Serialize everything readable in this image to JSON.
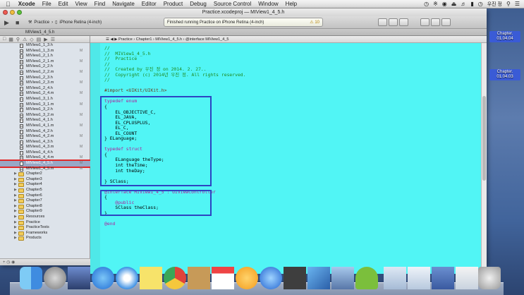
{
  "menubar": {
    "items": [
      "Xcode",
      "File",
      "Edit",
      "View",
      "Find",
      "Navigate",
      "Editor",
      "Product",
      "Debug",
      "Source Control",
      "Window",
      "Help"
    ],
    "user": "우진 정"
  },
  "window": {
    "title": "Practice.xcodeproj — MIView1_4_5.h",
    "scheme": "Practice",
    "destination": "iPhone Retina (4-inch)",
    "status": "Finished running Practice on iPhone Retina (4-inch)",
    "warning_count": "10",
    "tab": "MIView1_4_5.h"
  },
  "jumpbar": {
    "path": [
      "Practice",
      "Chapter1",
      "MIView1_4_5.h",
      "@interface MIView1_4_5"
    ]
  },
  "navigator": {
    "files": [
      {
        "type": "h",
        "name": "MIView1_1_3.h",
        "mark": ""
      },
      {
        "type": "m",
        "name": "MIView1_1_3.m",
        "mark": "M"
      },
      {
        "type": "h",
        "name": "MIView1_2_1.h",
        "mark": ""
      },
      {
        "type": "m",
        "name": "MIView1_2_1.m",
        "mark": "M"
      },
      {
        "type": "h",
        "name": "MIView1_2_2.h",
        "mark": ""
      },
      {
        "type": "m",
        "name": "MIView1_2_2.m",
        "mark": "M"
      },
      {
        "type": "h",
        "name": "MIView1_2_3.h",
        "mark": ""
      },
      {
        "type": "m",
        "name": "MIView1_2_3.m",
        "mark": "M"
      },
      {
        "type": "h",
        "name": "MIView1_2_4.h",
        "mark": ""
      },
      {
        "type": "m",
        "name": "MIView1_2_4.m",
        "mark": "M"
      },
      {
        "type": "h",
        "name": "MIView1_3_1.h",
        "mark": ""
      },
      {
        "type": "m",
        "name": "MIView1_3_1.m",
        "mark": "M"
      },
      {
        "type": "h",
        "name": "MIView1_3_2.h",
        "mark": ""
      },
      {
        "type": "m",
        "name": "MIView1_3_2.m",
        "mark": "M"
      },
      {
        "type": "h",
        "name": "MIView1_4_1.h",
        "mark": ""
      },
      {
        "type": "m",
        "name": "MIView1_4_1.m",
        "mark": "M"
      },
      {
        "type": "h",
        "name": "MIView1_4_2.h",
        "mark": ""
      },
      {
        "type": "m",
        "name": "MIView1_4_2.m",
        "mark": "M"
      },
      {
        "type": "h",
        "name": "MIView1_4_3.h",
        "mark": ""
      },
      {
        "type": "m",
        "name": "MIView1_4_3.m",
        "mark": "M"
      },
      {
        "type": "h",
        "name": "MIView1_4_4.h",
        "mark": ""
      },
      {
        "type": "m",
        "name": "MIView1_4_4.m",
        "mark": "M"
      },
      {
        "type": "h",
        "name": "MIView1_4_5.h",
        "mark": "M",
        "selected": true
      },
      {
        "type": "m",
        "name": "MIView1_4_5.m",
        "mark": "M"
      }
    ],
    "folders": [
      "Chapter2",
      "Chapter3",
      "Chapter4",
      "Chapter5",
      "Chapter6",
      "Chapter7",
      "Chapter8",
      "Chapter9",
      "Resources",
      "Practice",
      "PracticeTests",
      "Frameworks",
      "Products"
    ]
  },
  "code": {
    "lines": [
      {
        "cls": "cm",
        "text": "//"
      },
      {
        "cls": "cm",
        "text": "//  MIView1_4_5.h"
      },
      {
        "cls": "cm",
        "text": "//  Practice"
      },
      {
        "cls": "cm",
        "text": "//"
      },
      {
        "cls": "cm",
        "text": "//  Created by 우진 정 on 2014. 2. 27.."
      },
      {
        "cls": "cm",
        "text": "//  Copyright (c) 2014년 우진 정. All rights reserved."
      },
      {
        "cls": "cm",
        "text": "//"
      },
      {
        "cls": "",
        "text": ""
      },
      {
        "cls": "pp",
        "text": "#import <UIKit/UIKit.h>"
      },
      {
        "cls": "",
        "text": ""
      },
      {
        "cls": "kw",
        "text": "typedef enum"
      },
      {
        "cls": "",
        "text": "{"
      },
      {
        "cls": "",
        "text": "    EL_OBJECTIVE_C,"
      },
      {
        "cls": "",
        "text": "    EL_JAVA,"
      },
      {
        "cls": "",
        "text": "    EL_CPLUSPLUS,"
      },
      {
        "cls": "",
        "text": "    EL_C,"
      },
      {
        "cls": "",
        "text": "    EL_COUNT"
      },
      {
        "cls": "",
        "text": "} ELanguage;"
      },
      {
        "cls": "",
        "text": ""
      },
      {
        "cls": "kw",
        "text": "typedef struct"
      },
      {
        "cls": "",
        "text": "{"
      },
      {
        "cls": "",
        "text": "    ELanguage theType;"
      },
      {
        "cls": "",
        "text": "    int theTime;"
      },
      {
        "cls": "",
        "text": "    int theDay;"
      },
      {
        "cls": "",
        "text": ""
      },
      {
        "cls": "",
        "text": "} SClass;"
      },
      {
        "cls": "",
        "text": ""
      },
      {
        "cls": "kw",
        "text": "@interface MIView1_4_5 : UIViewController"
      },
      {
        "cls": "",
        "text": "{"
      },
      {
        "cls": "kw",
        "text": "    @public"
      },
      {
        "cls": "",
        "text": "    SClass theClass;"
      },
      {
        "cls": "",
        "text": "}"
      },
      {
        "cls": "",
        "text": ""
      },
      {
        "cls": "kw",
        "text": "@end"
      }
    ]
  },
  "desktop": {
    "icons": [
      {
        "label": "Chapter.\n01.04.04"
      },
      {
        "label": "Chapter.\n01.04.03"
      }
    ]
  },
  "colors": {
    "editor_bg": "#51f5f5",
    "highlight_box": "#2d45c2",
    "selection_outline": "#e02a2a"
  }
}
